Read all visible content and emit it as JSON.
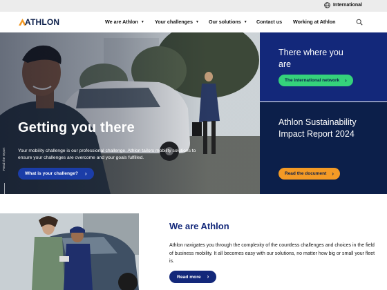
{
  "topbar": {
    "language_label": "International"
  },
  "nav": {
    "logo_text": "ATHLON",
    "items": [
      {
        "label": "We are Athlon",
        "dropdown": true
      },
      {
        "label": "Your challenges",
        "dropdown": true
      },
      {
        "label": "Our solutions",
        "dropdown": true
      },
      {
        "label": "Contact us",
        "dropdown": false
      },
      {
        "label": "Working at Athlon",
        "dropdown": false
      }
    ],
    "search_icon": "search-icon"
  },
  "hero": {
    "title": "Getting you there",
    "text": "Your mobility challenge is our professional challenge. Athlon tailors mobility solutions to ensure your challenges are overcome and your goals fulfilled.",
    "button_label": "What is your challenge?",
    "side_label": "Read the report"
  },
  "panels": {
    "network": {
      "title": "There where you are",
      "button_label": "The international network",
      "color": "#13287a",
      "button_color": "#35d27b"
    },
    "report": {
      "title": "Athlon Sustainability Impact Report 2024",
      "button_label": "Read the document",
      "color": "#0c1f4a",
      "button_color": "#f39a25"
    }
  },
  "about": {
    "title": "We are Athlon",
    "text": "Athlon navigates you through the complexity of the countless challenges and choices in the field of business mobility. It all becomes easy with our solutions, no matter how big or small your fleet is.",
    "button_label": "Read more"
  },
  "colors": {
    "brand_navy": "#0c1f4a",
    "brand_blue": "#13287a",
    "accent_orange": "#f39a25",
    "accent_green": "#35d27b"
  }
}
